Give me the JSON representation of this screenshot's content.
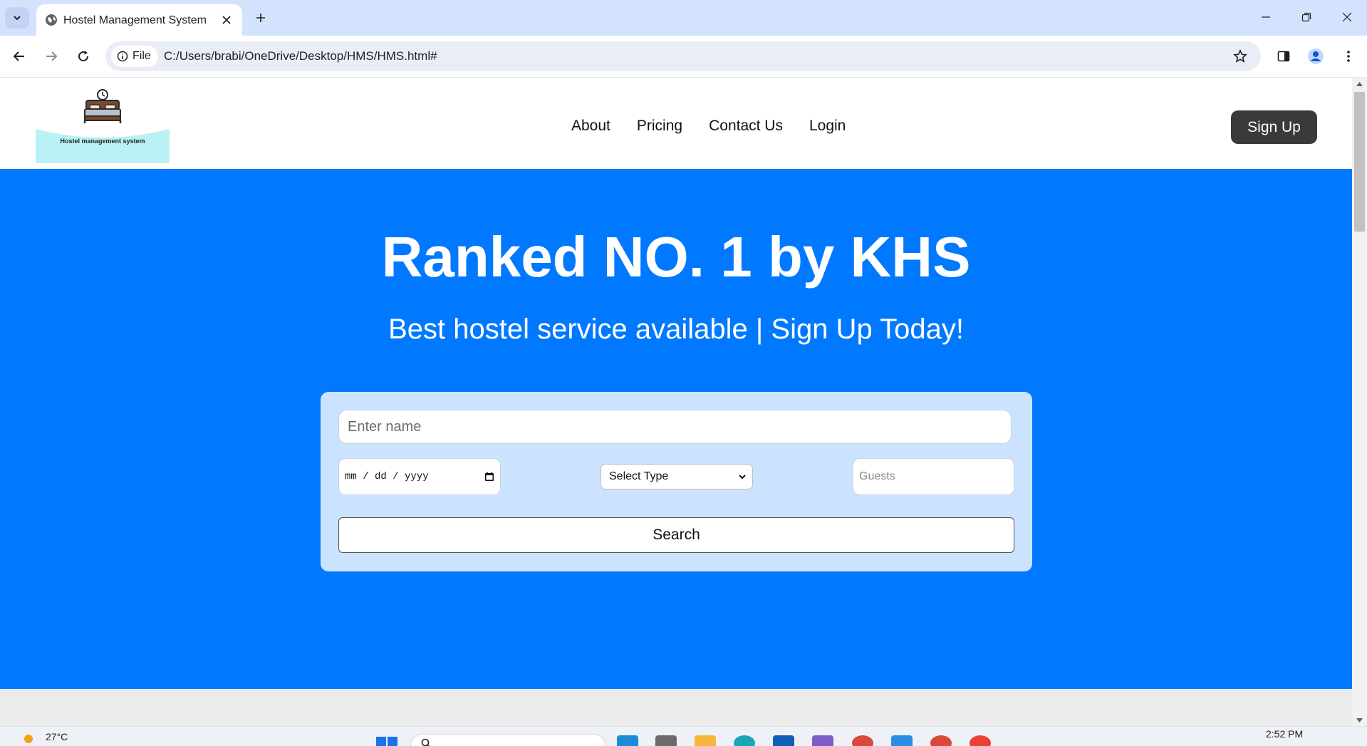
{
  "browser": {
    "tab_title": "Hostel Management System",
    "file_chip": "File",
    "url": "C:/Users/brabi/OneDrive/Desktop/HMS/HMS.html#"
  },
  "site": {
    "logo_text": "Hostel management system",
    "nav": [
      "About",
      "Pricing",
      "Contact Us",
      "Login"
    ],
    "signup_label": "Sign Up"
  },
  "hero": {
    "title": "Ranked NO. 1 by KHS",
    "subtitle": "Best hostel service available | Sign Up Today!"
  },
  "search_form": {
    "name_placeholder": "Enter name",
    "date_placeholder": "mm / dd / yyyy",
    "type_select_value": "Select Type",
    "guests_placeholder": "Guests",
    "search_label": "Search"
  },
  "taskbar": {
    "temperature": "27°C",
    "time": "2:52 PM"
  },
  "colors": {
    "hero_bg": "#0079ff",
    "card_bg": "#cce3ff",
    "signup_bg": "#3a3a3a",
    "tabbar_bg": "#d3e3fd"
  }
}
